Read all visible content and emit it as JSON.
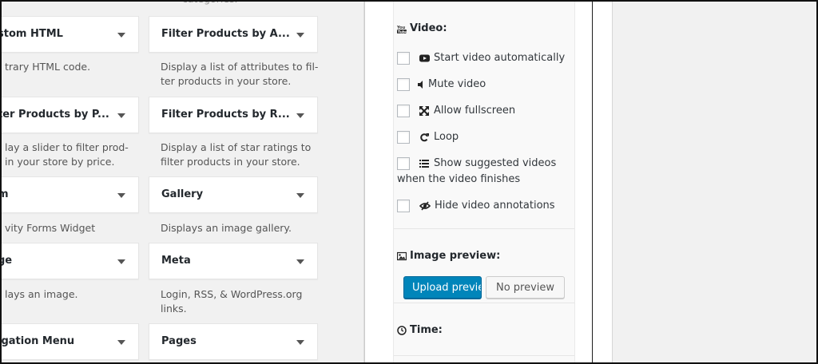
{
  "widgets_left": [
    {
      "title": "stom HTML",
      "desc": "trary HTML code."
    },
    {
      "title": "ter Products by P...",
      "desc": "lay a slider to filter prod-\nin your store by price."
    },
    {
      "title": "m",
      "desc": "vity Forms Widget"
    },
    {
      "title": "ge",
      "desc": "lays an image."
    },
    {
      "title": "igation Menu",
      "desc": ""
    }
  ],
  "widgets_right": [
    {
      "title": "Filter Products by A...",
      "desc": "Display a list of attributes to fil-\nter products in your store."
    },
    {
      "title": "Filter Products by R...",
      "desc": "Display a list of star ratings to\nfilter products in your store."
    },
    {
      "title": "Gallery",
      "desc": "Displays an image gallery."
    },
    {
      "title": "Meta",
      "desc": "Login, RSS, & WordPress.org\nlinks."
    },
    {
      "title": "Pages",
      "desc": ""
    }
  ],
  "top_snippet": "categories.",
  "video": {
    "heading": "Video:",
    "options": [
      {
        "label": "Start video automatically",
        "icon": "youtube-icon"
      },
      {
        "label": "Mute video",
        "icon": "volume-icon"
      },
      {
        "label": "Allow fullscreen",
        "icon": "fullscreen-icon"
      },
      {
        "label": "Loop",
        "icon": "loop-icon"
      },
      {
        "label": "Show suggested videos",
        "label2": "when the video finishes",
        "icon": "list-icon"
      },
      {
        "label": "Hide video annotations",
        "icon": "eye-slash-icon"
      }
    ]
  },
  "image_preview": {
    "heading": "Image preview:",
    "upload_label": "Upload preview",
    "no_preview_label": "No preview"
  },
  "time": {
    "heading": "Time:"
  },
  "colors": {
    "primary": "#0085ba",
    "bg": "#f1f1f1"
  }
}
